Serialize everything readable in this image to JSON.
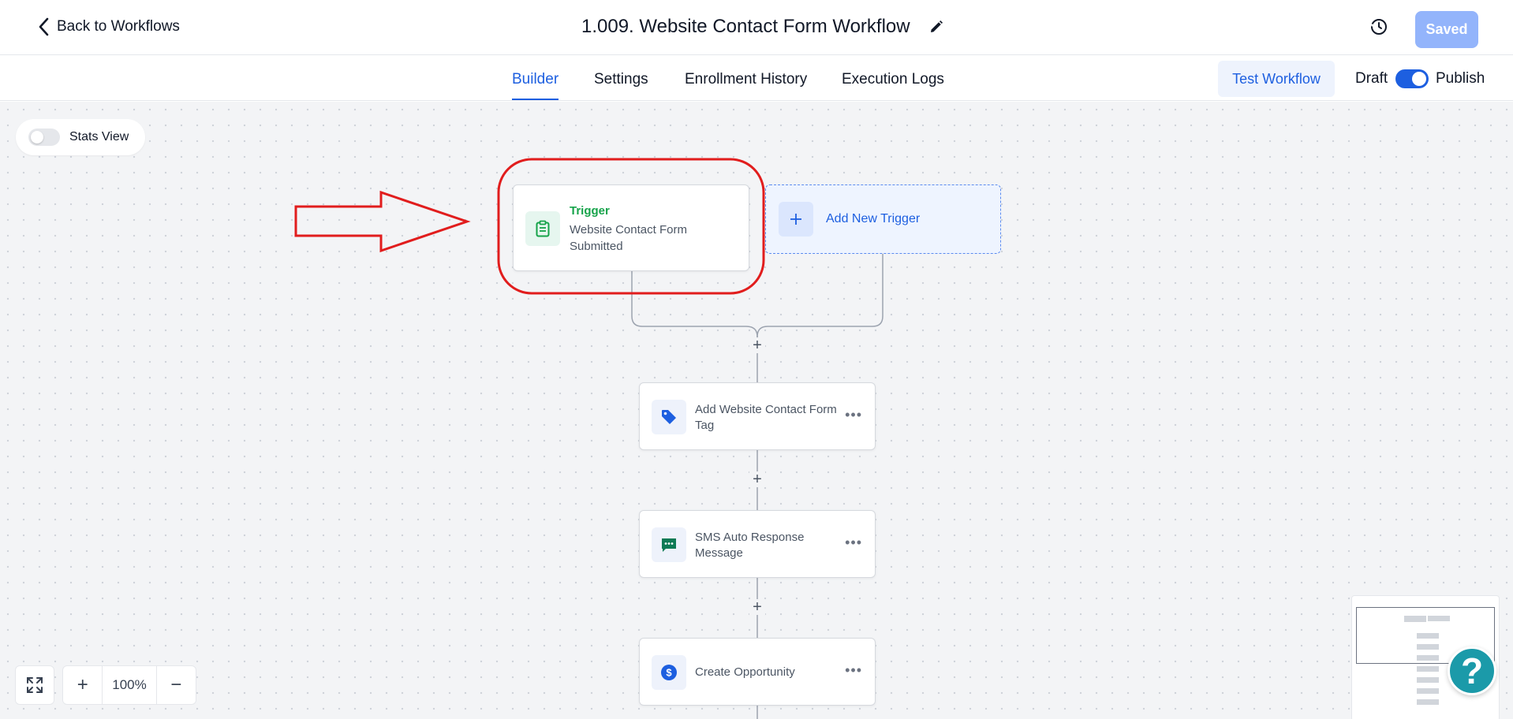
{
  "header": {
    "back_label": "Back to Workflows",
    "title": "1.009. Website Contact Form Workflow",
    "saved_label": "Saved"
  },
  "tabs": {
    "builder": "Builder",
    "settings": "Settings",
    "enrollment": "Enrollment History",
    "logs": "Execution Logs",
    "active": "Builder"
  },
  "actions": {
    "test_workflow": "Test Workflow",
    "draft": "Draft",
    "publish": "Publish",
    "publish_toggle_on": true
  },
  "canvas": {
    "stats_view_label": "Stats View",
    "stats_view_on": false,
    "trigger": {
      "title": "Trigger",
      "subtitle": "Website Contact Form Submitted"
    },
    "add_trigger_label": "Add New Trigger",
    "steps": [
      {
        "label": "Add Website Contact Form Tag",
        "icon": "tag-icon"
      },
      {
        "label": "SMS Auto Response Message",
        "icon": "sms-icon"
      },
      {
        "label": "Create Opportunity",
        "icon": "dollar-icon"
      }
    ],
    "zoom_level": "100%"
  },
  "help": {
    "symbol": "?"
  },
  "colors": {
    "accent": "#1d5fe0",
    "trigger_green": "#16a34a",
    "annotation_red": "#e11d1d",
    "help_teal": "#1b9aa9"
  }
}
